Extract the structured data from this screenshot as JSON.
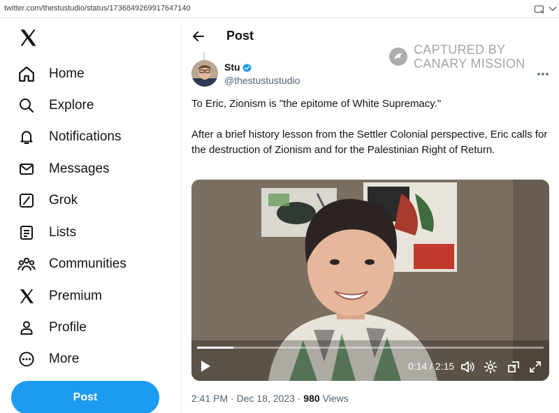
{
  "browser": {
    "url": "twitter.com/thestustudio/status/1736849269917647140",
    "screenshot_icon": "screenshot-icon",
    "zoom_icon": "zoom-icon"
  },
  "sidebar": {
    "logo": "x-logo-icon",
    "items": [
      {
        "label": "Home",
        "icon": "home-icon"
      },
      {
        "label": "Explore",
        "icon": "search-icon"
      },
      {
        "label": "Notifications",
        "icon": "bell-icon"
      },
      {
        "label": "Messages",
        "icon": "envelope-icon"
      },
      {
        "label": "Grok",
        "icon": "grok-icon"
      },
      {
        "label": "Lists",
        "icon": "list-icon"
      },
      {
        "label": "Communities",
        "icon": "communities-icon"
      },
      {
        "label": "Premium",
        "icon": "x-premium-icon"
      },
      {
        "label": "Profile",
        "icon": "person-icon"
      },
      {
        "label": "More",
        "icon": "more-circle-icon"
      }
    ],
    "post_button": "Post"
  },
  "header": {
    "title": "Post"
  },
  "watermark": {
    "line1": "CAPTURED BY",
    "line2": "CANARY MISSION"
  },
  "tweet": {
    "author_name": "Stu",
    "author_handle": "@thestustustudio",
    "text_1": "To Eric, Zionism is \"the epitome of White Supremacy.\"",
    "text_2": "After a brief history lesson from the Settler Colonial perspective, Eric calls for the destruction of Zionism and for the Palestinian Right of Return.",
    "video": {
      "current_time": "0:14",
      "separator": "/",
      "duration": "2:15",
      "progress_fraction": 0.104
    },
    "timestamp": "2:41 PM · Dec 18, 2023 · ",
    "views_count": "980",
    "views_label": "Views"
  },
  "colors": {
    "accent": "#1d9bf0",
    "text": "#0f1419",
    "secondary": "#536471"
  }
}
